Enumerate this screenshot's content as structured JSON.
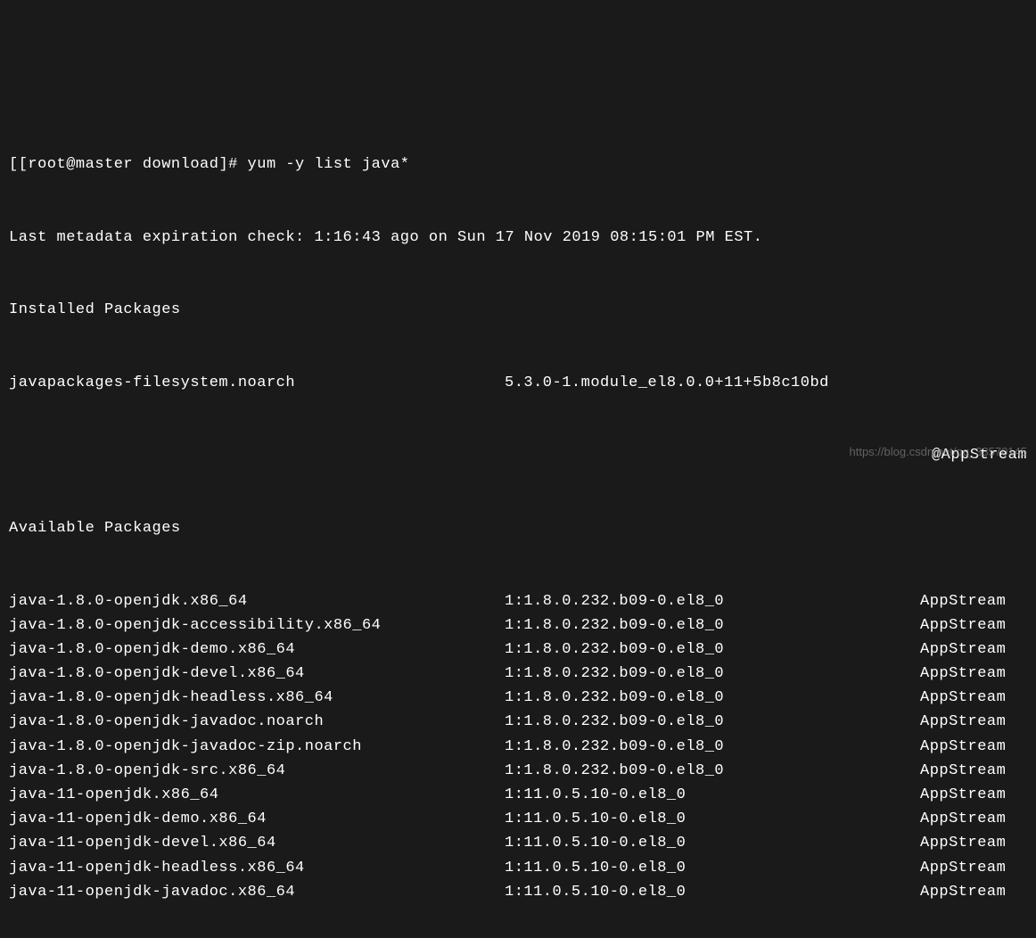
{
  "prompt": {
    "bracket_open": "[",
    "user_host": "[root@master download]#",
    "command": " yum -y list java*"
  },
  "metadata_line": "Last metadata expiration check: 1:16:43 ago on Sun 17 Nov 2019 08:15:01 PM EST.",
  "installed_header": "Installed Packages",
  "installed_package": {
    "name": "javapackages-filesystem.noarch",
    "version": "5.3.0-1.module_el8.0.0+11+5b8c10bd",
    "repo": "@AppStream"
  },
  "available_header": "Available Packages",
  "available_packages": [
    {
      "name": "java-1.8.0-openjdk.x86_64",
      "version": "1:1.8.0.232.b09-0.el8_0",
      "repo": "AppStream"
    },
    {
      "name": "java-1.8.0-openjdk-accessibility.x86_64",
      "version": "1:1.8.0.232.b09-0.el8_0",
      "repo": "AppStream"
    },
    {
      "name": "java-1.8.0-openjdk-demo.x86_64",
      "version": "1:1.8.0.232.b09-0.el8_0",
      "repo": "AppStream"
    },
    {
      "name": "java-1.8.0-openjdk-devel.x86_64",
      "version": "1:1.8.0.232.b09-0.el8_0",
      "repo": "AppStream"
    },
    {
      "name": "java-1.8.0-openjdk-headless.x86_64",
      "version": "1:1.8.0.232.b09-0.el8_0",
      "repo": "AppStream"
    },
    {
      "name": "java-1.8.0-openjdk-javadoc.noarch",
      "version": "1:1.8.0.232.b09-0.el8_0",
      "repo": "AppStream"
    },
    {
      "name": "java-1.8.0-openjdk-javadoc-zip.noarch",
      "version": "1:1.8.0.232.b09-0.el8_0",
      "repo": "AppStream"
    },
    {
      "name": "java-1.8.0-openjdk-src.x86_64",
      "version": "1:1.8.0.232.b09-0.el8_0",
      "repo": "AppStream"
    },
    {
      "name": "java-11-openjdk.x86_64",
      "version": "1:11.0.5.10-0.el8_0",
      "repo": "AppStream"
    },
    {
      "name": "java-11-openjdk-demo.x86_64",
      "version": "1:11.0.5.10-0.el8_0",
      "repo": "AppStream"
    },
    {
      "name": "java-11-openjdk-devel.x86_64",
      "version": "1:11.0.5.10-0.el8_0",
      "repo": "AppStream"
    },
    {
      "name": "java-11-openjdk-headless.x86_64",
      "version": "1:11.0.5.10-0.el8_0",
      "repo": "AppStream"
    },
    {
      "name": "java-11-openjdk-javadoc.x86_64",
      "version": "1:11.0.5.10-0.el8_0",
      "repo": "AppStream"
    }
  ],
  "watermark": "https://blog.csdn.net/qq_33570145"
}
